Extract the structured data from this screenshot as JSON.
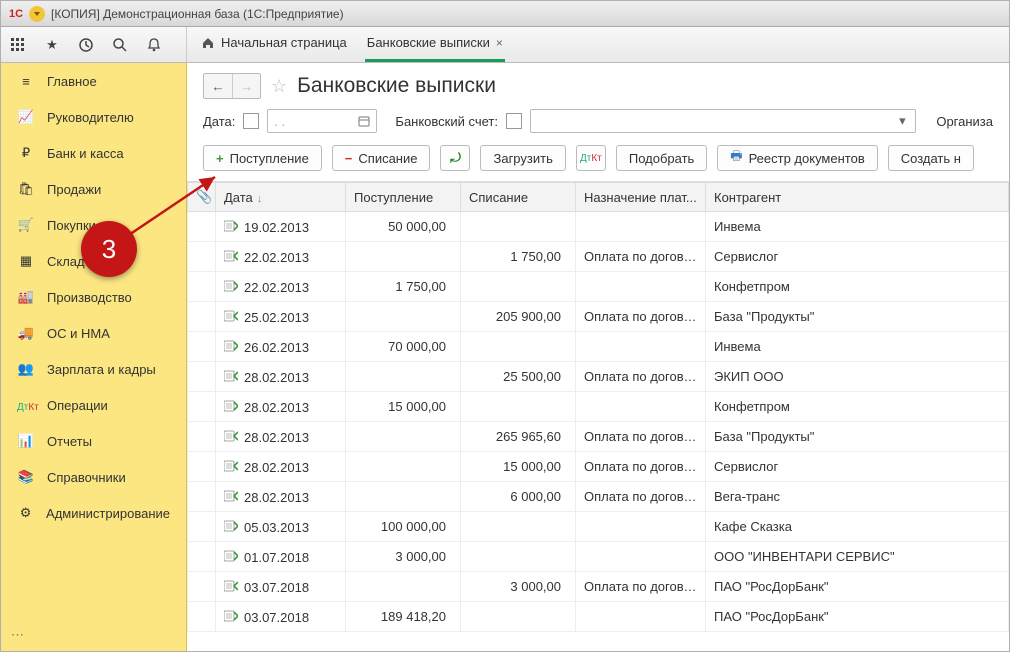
{
  "titlebar": {
    "text": "[КОПИЯ] Демонстрационная база  (1С:Предприятие)"
  },
  "tabs": {
    "home": "Начальная страница",
    "active": "Банковские выписки"
  },
  "sidebar": {
    "items": [
      "Главное",
      "Руководителю",
      "Банк и касса",
      "Продажи",
      "Покупки",
      "Склад",
      "Производство",
      "ОС и НМА",
      "Зарплата и кадры",
      "Операции",
      "Отчеты",
      "Справочники",
      "Администрирование"
    ]
  },
  "page": {
    "title": "Банковские выписки"
  },
  "filters": {
    "date_label": "Дата:",
    "date_placeholder": ".  .",
    "account_label": "Банковский счет:",
    "org_label": "Организа"
  },
  "toolbar": {
    "income": "Поступление",
    "outcome": "Списание",
    "load": "Загрузить",
    "pick": "Подобрать",
    "registry": "Реестр документов",
    "create": "Создать н"
  },
  "table": {
    "headers": {
      "attach": "",
      "date": "Дата",
      "income": "Поступление",
      "outcome": "Списание",
      "purpose": "Назначение плат...",
      "agent": "Контрагент"
    },
    "rows": [
      {
        "dir": "in",
        "date": "19.02.2013",
        "income": "50 000,00",
        "outcome": "",
        "purpose": "",
        "agent": "Инвема"
      },
      {
        "dir": "out",
        "date": "22.02.2013",
        "income": "",
        "outcome": "1 750,00",
        "purpose": "Оплата по догово...",
        "agent": "Сервислог"
      },
      {
        "dir": "in",
        "date": "22.02.2013",
        "income": "1 750,00",
        "outcome": "",
        "purpose": "",
        "agent": "Конфетпром"
      },
      {
        "dir": "out",
        "date": "25.02.2013",
        "income": "",
        "outcome": "205 900,00",
        "purpose": "Оплата по догово...",
        "agent": "База \"Продукты\""
      },
      {
        "dir": "in",
        "date": "26.02.2013",
        "income": "70 000,00",
        "outcome": "",
        "purpose": "",
        "agent": "Инвема"
      },
      {
        "dir": "out",
        "date": "28.02.2013",
        "income": "",
        "outcome": "25 500,00",
        "purpose": "Оплата по догово...",
        "agent": "ЭКИП ООО"
      },
      {
        "dir": "in",
        "date": "28.02.2013",
        "income": "15 000,00",
        "outcome": "",
        "purpose": "",
        "agent": "Конфетпром"
      },
      {
        "dir": "out",
        "date": "28.02.2013",
        "income": "",
        "outcome": "265 965,60",
        "purpose": "Оплата по догово...",
        "agent": "База \"Продукты\""
      },
      {
        "dir": "out",
        "date": "28.02.2013",
        "income": "",
        "outcome": "15 000,00",
        "purpose": "Оплата по догово...",
        "agent": "Сервислог"
      },
      {
        "dir": "out",
        "date": "28.02.2013",
        "income": "",
        "outcome": "6 000,00",
        "purpose": "Оплата по догово...",
        "agent": "Вега-транс"
      },
      {
        "dir": "in",
        "date": "05.03.2013",
        "income": "100 000,00",
        "outcome": "",
        "purpose": "",
        "agent": "Кафе Сказка"
      },
      {
        "dir": "in",
        "date": "01.07.2018",
        "income": "3 000,00",
        "outcome": "",
        "purpose": "",
        "agent": "ООО \"ИНВЕНТАРИ СЕРВИС\""
      },
      {
        "dir": "out",
        "date": "03.07.2018",
        "income": "",
        "outcome": "3 000,00",
        "purpose": "Оплата по догово...",
        "agent": "ПАО \"РосДорБанк\""
      },
      {
        "dir": "in",
        "date": "03.07.2018",
        "income": "189 418,20",
        "outcome": "",
        "purpose": "",
        "agent": "ПАО \"РосДорБанк\""
      }
    ]
  },
  "callout": "3"
}
